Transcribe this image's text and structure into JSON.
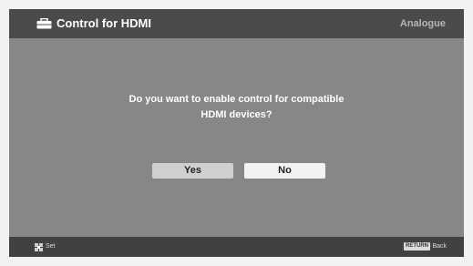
{
  "header": {
    "title": "Control for HDMI",
    "source": "Analogue",
    "icon": "toolbox-icon"
  },
  "dialog": {
    "question_line1": "Do you want to enable control for compatible",
    "question_line2": "HDMI devices?",
    "yes_label": "Yes",
    "no_label": "No",
    "selected": "No"
  },
  "footer": {
    "set_icon": "dpad-icon",
    "set_label": "Set",
    "return_key_label": "RETURN",
    "back_label": "Back"
  },
  "colors": {
    "background": "#878787",
    "header_bar": "#4b4b4b",
    "footer_bar": "#414141",
    "button_selected": "#f2f2f2",
    "button_unselected": "#cfcfcf"
  }
}
